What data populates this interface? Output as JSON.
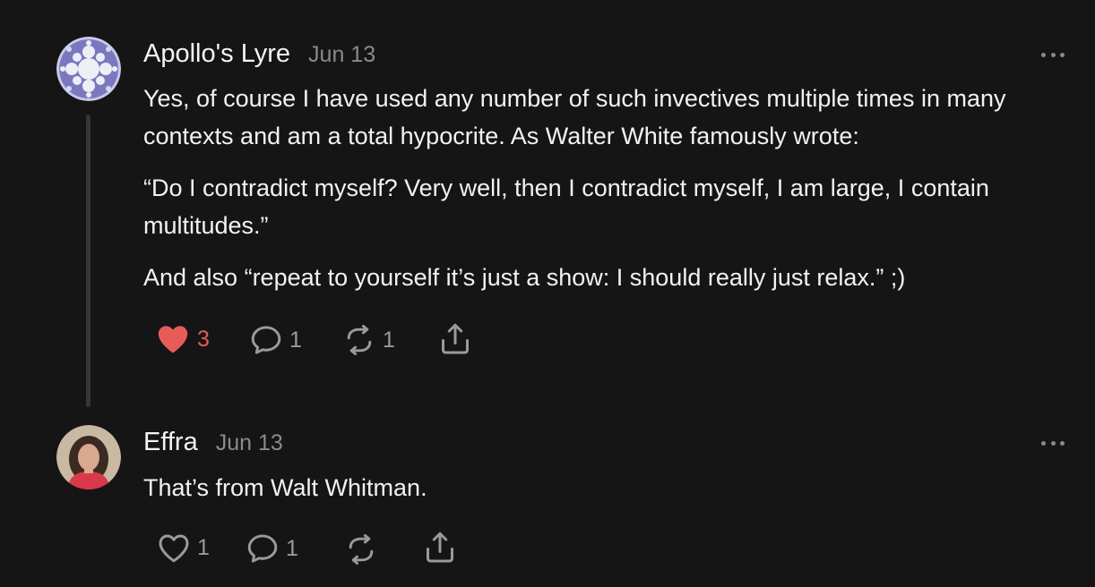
{
  "comments": [
    {
      "author": "Apollo's Lyre",
      "date": "Jun 13",
      "paragraphs": [
        "Yes, of course I have used any number of such invectives multiple times in many contexts and am a total hypocrite. As Walter White famously wrote:",
        "“Do I contradict myself? Very well, then I contradict myself, I am large, I contain multitudes.”",
        "And also “repeat to yourself it’s just a show: I should really just relax.” ;)"
      ],
      "likes": "3",
      "liked": true,
      "replies": "1",
      "restacks": "1",
      "avatar_icon": "fractal-avatar-icon"
    },
    {
      "author": "Effra",
      "date": "Jun 13",
      "paragraphs": [
        "That’s from Walt Whitman."
      ],
      "likes": "1",
      "liked": false,
      "replies": "1",
      "restacks": "",
      "avatar_icon": "profile-photo"
    }
  ],
  "colors": {
    "background": "#151516",
    "liked": "#e85c58",
    "muted": "#8a8a8e",
    "text": "#f2f2f2"
  }
}
